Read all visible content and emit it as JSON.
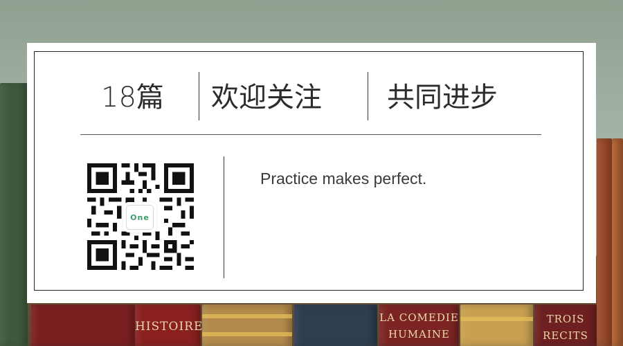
{
  "headline": {
    "count": "18篇",
    "welcome": "欢迎关注",
    "progress": "共同进步"
  },
  "tagline": "Practice makes perfect.",
  "qr": {
    "badge": "One"
  },
  "books": [
    {
      "spine": "HISTOIRE"
    },
    {
      "spine": "LA COMEDIE"
    },
    {
      "spine": "HUMAINE"
    },
    {
      "spine": "TROIS"
    },
    {
      "spine": "RECITS"
    }
  ],
  "colors": {
    "card": "#ffffff",
    "text": "#2c2c2c",
    "accent": "#3a9f6a"
  }
}
